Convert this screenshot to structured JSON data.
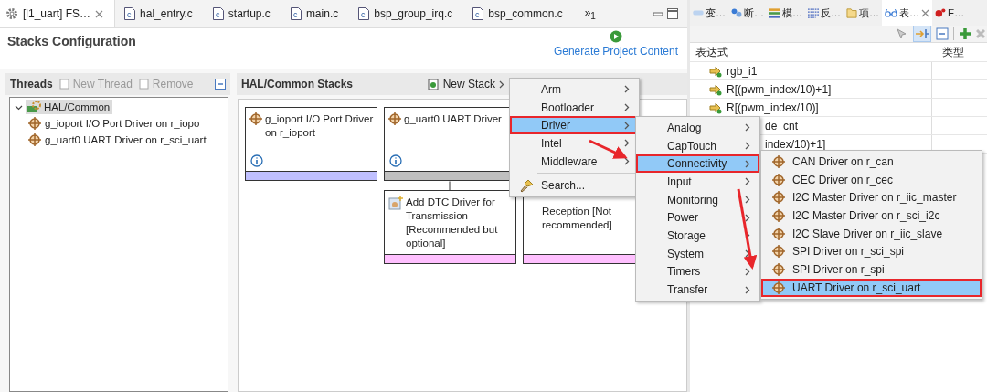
{
  "editor_tabs": [
    {
      "label": "[l1_uart] FS…",
      "kind": "config",
      "selected": true
    },
    {
      "label": "hal_entry.c",
      "kind": "c",
      "selected": false
    },
    {
      "label": "startup.c",
      "kind": "c",
      "selected": false
    },
    {
      "label": "main.c",
      "kind": "c",
      "selected": false
    },
    {
      "label": "bsp_group_irq.c",
      "kind": "c",
      "selected": false
    },
    {
      "label": "bsp_common.c",
      "kind": "c",
      "selected": false
    }
  ],
  "tab_overflow": "»$_{1}$",
  "page": {
    "title": "Stacks Configuration",
    "generate_link": "Generate Project Content"
  },
  "threads": {
    "title": "Threads",
    "actions": [
      {
        "label": "New Thread",
        "disabled": true
      },
      {
        "label": "Remove",
        "disabled": true
      }
    ],
    "tree": [
      {
        "label": "HAL/Common",
        "expanded": true,
        "selected": true,
        "children": [
          {
            "label": "g_ioport I/O Port Driver on r_iopo"
          },
          {
            "label": "g_uart0 UART Driver on r_sci_uart"
          }
        ]
      }
    ]
  },
  "stacks": {
    "title": "HAL/Common Stacks",
    "new_stack": "New Stack",
    "cards": [
      {
        "kind": "module",
        "title": "g_ioport I/O Port Driver on r_ioport",
        "color": "#c0c0ff"
      },
      {
        "kind": "module",
        "title": "g_uart0 UART Driver",
        "color": "#c0c0c0",
        "children": [
          {
            "kind": "dtc",
            "title": "Add DTC Driver for Transmission [Recommended but optional]",
            "color": "#ffc0ff"
          },
          {
            "kind": "dtc_covered",
            "title": "Reception [Not recommended]",
            "color": "#ffc0ff"
          }
        ]
      }
    ]
  },
  "menus": [
    {
      "items": [
        {
          "kind": "submenu",
          "label": "Arm",
          "selected": false
        },
        {
          "kind": "submenu",
          "label": "Bootloader",
          "selected": false
        },
        {
          "kind": "submenu",
          "label": "Driver",
          "selected": true
        },
        {
          "kind": "submenu",
          "label": "Intel",
          "selected": false
        },
        {
          "kind": "submenu",
          "label": "Middleware",
          "selected": false
        },
        {
          "kind": "search",
          "label": "Search...",
          "selected": false
        }
      ]
    },
    {
      "items": [
        {
          "kind": "submenu",
          "label": "Analog",
          "selected": false
        },
        {
          "kind": "submenu",
          "label": "CapTouch",
          "selected": false
        },
        {
          "kind": "submenu",
          "label": "Connectivity",
          "selected": true
        },
        {
          "kind": "submenu",
          "label": "Input",
          "selected": false
        },
        {
          "kind": "submenu",
          "label": "Monitoring",
          "selected": false
        },
        {
          "kind": "submenu",
          "label": "Power",
          "selected": false
        },
        {
          "kind": "submenu",
          "label": "Storage",
          "selected": false
        },
        {
          "kind": "submenu",
          "label": "System",
          "selected": false
        },
        {
          "kind": "submenu",
          "label": "Timers",
          "selected": false
        },
        {
          "kind": "submenu",
          "label": "Transfer",
          "selected": false
        }
      ]
    },
    {
      "items": [
        {
          "kind": "module",
          "label": "CAN Driver on r_can",
          "selected": false
        },
        {
          "kind": "module",
          "label": "CEC Driver on r_cec",
          "selected": false
        },
        {
          "kind": "module",
          "label": "I2C Master Driver on r_iic_master",
          "selected": false
        },
        {
          "kind": "module",
          "label": "I2C Master Driver on r_sci_i2c",
          "selected": false
        },
        {
          "kind": "module",
          "label": "I2C Slave Driver on r_iic_slave",
          "selected": false
        },
        {
          "kind": "module",
          "label": "SPI Driver on r_sci_spi",
          "selected": false
        },
        {
          "kind": "module",
          "label": "SPI Driver on r_spi",
          "selected": false
        },
        {
          "kind": "module",
          "label": "UART Driver on r_sci_uart",
          "selected": true
        }
      ]
    }
  ],
  "right_panel": {
    "tabs": [
      {
        "label": "变…",
        "kind": "variables",
        "selected": false
      },
      {
        "label": "断…",
        "kind": "breakpoints",
        "selected": false
      },
      {
        "label": "模…",
        "kind": "modules",
        "selected": false
      },
      {
        "label": "反…",
        "kind": "disassembly",
        "selected": false
      },
      {
        "label": "项…",
        "kind": "project",
        "selected": false
      },
      {
        "label": "表…",
        "kind": "expressions",
        "selected": true
      },
      {
        "label": "E…",
        "kind": "errors",
        "selected": false
      }
    ],
    "columns": [
      "表达式",
      "类型"
    ],
    "rows": [
      {
        "kind": "full",
        "expression": "rgb_i1"
      },
      {
        "kind": "full",
        "expression": "R[(pwm_index/10)+1]"
      },
      {
        "kind": "full",
        "expression": "R[(pwm_index/10)]"
      },
      {
        "kind": "partial",
        "expression": "de_cnt"
      },
      {
        "kind": "partial",
        "expression": "index/10)+1]"
      }
    ]
  }
}
